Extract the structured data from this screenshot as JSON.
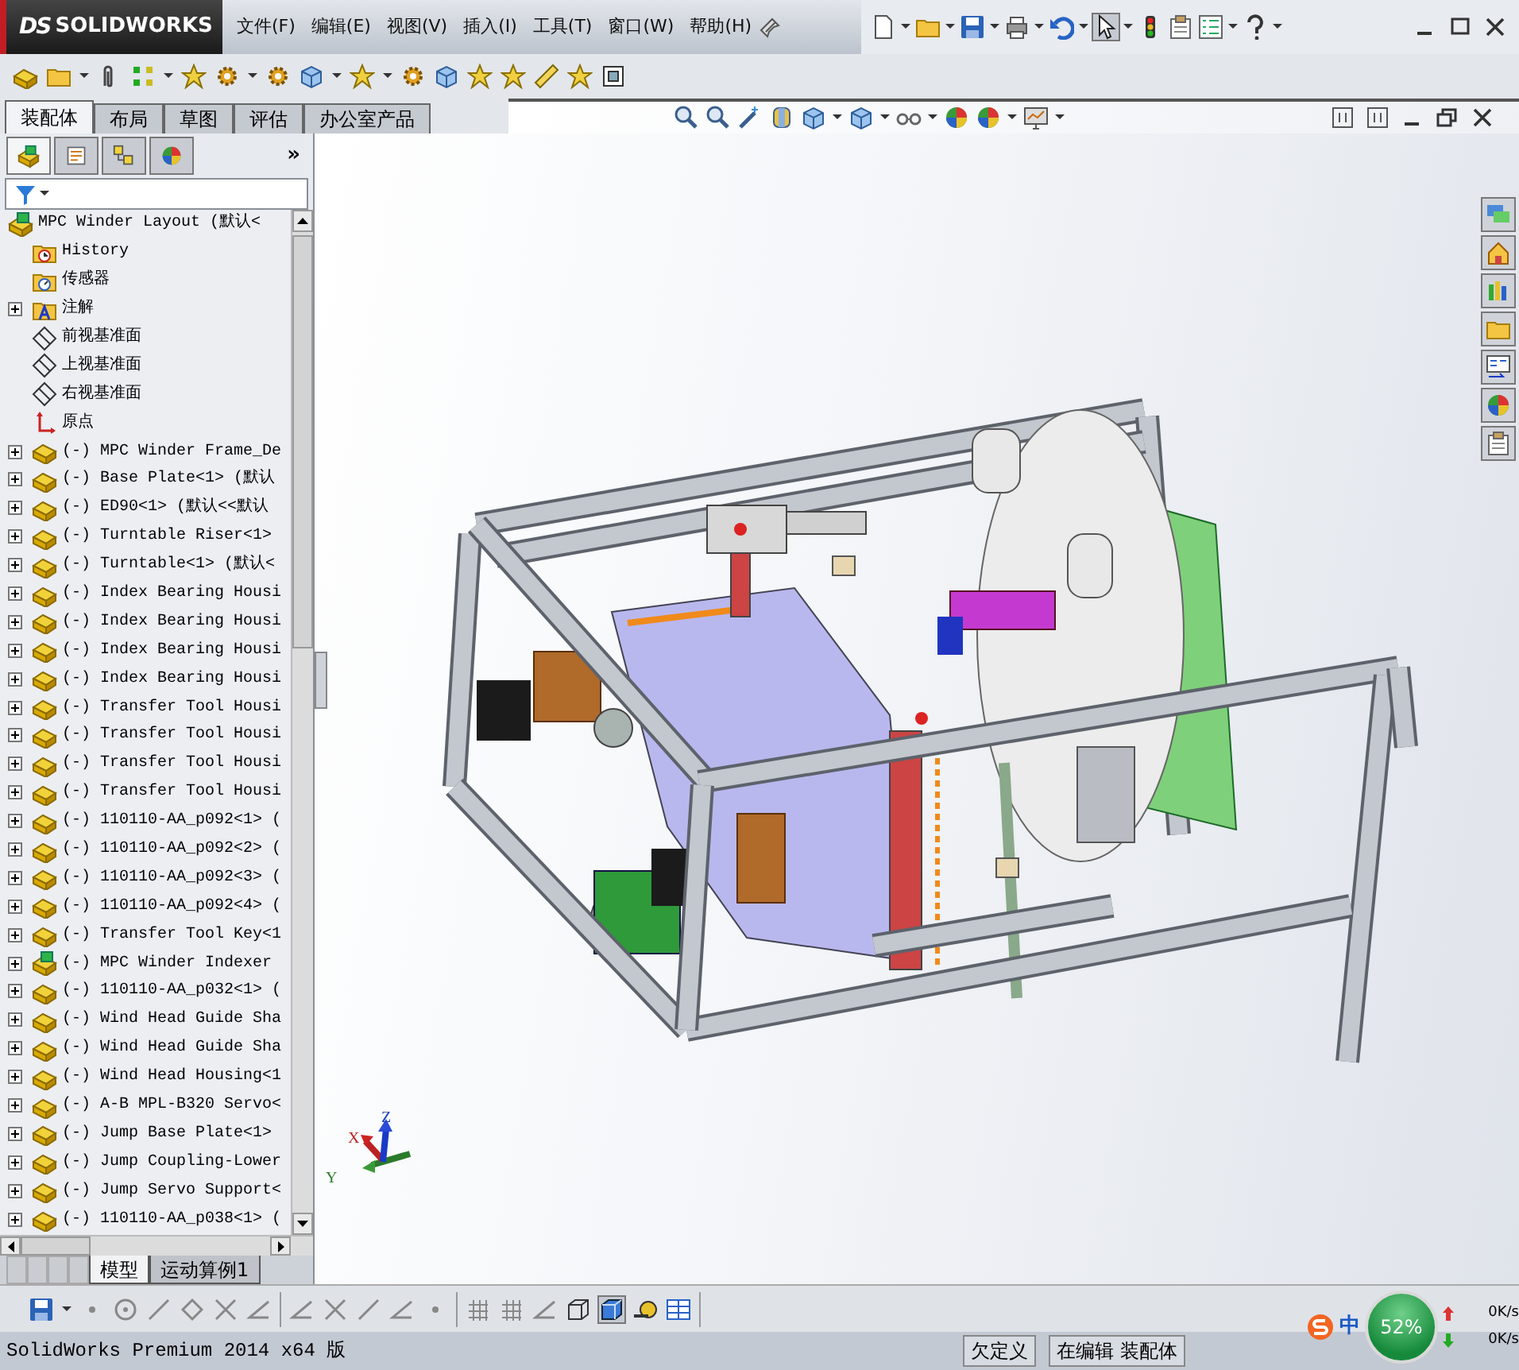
{
  "app": {
    "logo_mark": "DS",
    "logo_text": "SOLIDWORKS"
  },
  "menus": [
    "文件(F)",
    "编辑(E)",
    "视图(V)",
    "插入(I)",
    "工具(T)",
    "窗口(W)",
    "帮助(H)"
  ],
  "command_tabs": [
    {
      "label": "装配体",
      "selected": true
    },
    {
      "label": "布局",
      "selected": false
    },
    {
      "label": "草图",
      "selected": false
    },
    {
      "label": "评估",
      "selected": false
    },
    {
      "label": "办公室产品",
      "selected": false
    }
  ],
  "panel_tabs": [
    {
      "kind": "feature-tree",
      "selected": true
    },
    {
      "kind": "properties",
      "selected": false
    },
    {
      "kind": "configurations",
      "selected": false
    },
    {
      "kind": "display",
      "selected": false
    }
  ],
  "panel_more": "»",
  "tree": [
    {
      "kind": "assembly",
      "label": "MPC Winder Layout  (默认<",
      "children": [
        {
          "kind": "history",
          "label": "History",
          "expandable": false
        },
        {
          "kind": "sensors",
          "label": "传感器",
          "expandable": false
        },
        {
          "kind": "annotations",
          "label": "注解",
          "expandable": true
        },
        {
          "kind": "plane",
          "label": "前视基准面",
          "expandable": false
        },
        {
          "kind": "plane",
          "label": "上视基准面",
          "expandable": false
        },
        {
          "kind": "plane",
          "label": "右视基准面",
          "expandable": false
        },
        {
          "kind": "origin",
          "label": "原点",
          "expandable": false
        },
        {
          "kind": "part",
          "label": "(-) MPC Winder Frame_De",
          "expandable": true
        },
        {
          "kind": "part",
          "label": "(-) Base Plate<1> (默认",
          "expandable": true
        },
        {
          "kind": "part",
          "label": "(-) ED90<1> (默认<<默认",
          "expandable": true
        },
        {
          "kind": "part",
          "label": "(-) Turntable Riser<1>",
          "expandable": true
        },
        {
          "kind": "part",
          "label": "(-) Turntable<1> (默认<",
          "expandable": true
        },
        {
          "kind": "part",
          "label": "(-) Index Bearing Housi",
          "expandable": true
        },
        {
          "kind": "part",
          "label": "(-) Index Bearing Housi",
          "expandable": true
        },
        {
          "kind": "part",
          "label": "(-) Index Bearing Housi",
          "expandable": true
        },
        {
          "kind": "part",
          "label": "(-) Index Bearing Housi",
          "expandable": true
        },
        {
          "kind": "part",
          "label": "(-) Transfer Tool Housi",
          "expandable": true
        },
        {
          "kind": "part",
          "label": "(-) Transfer Tool Housi",
          "expandable": true
        },
        {
          "kind": "part",
          "label": "(-) Transfer Tool Housi",
          "expandable": true
        },
        {
          "kind": "part",
          "label": "(-) Transfer Tool Housi",
          "expandable": true
        },
        {
          "kind": "part",
          "label": "(-) 110110-AA_p092<1> (",
          "expandable": true
        },
        {
          "kind": "part",
          "label": "(-) 110110-AA_p092<2> (",
          "expandable": true
        },
        {
          "kind": "part",
          "label": "(-) 110110-AA_p092<3> (",
          "expandable": true
        },
        {
          "kind": "part",
          "label": "(-) 110110-AA_p092<4> (",
          "expandable": true
        },
        {
          "kind": "part",
          "label": "(-) Transfer Tool Key<1",
          "expandable": true
        },
        {
          "kind": "subassembly",
          "label": "(-) MPC Winder Indexer",
          "expandable": true
        },
        {
          "kind": "part",
          "label": "(-) 110110-AA_p032<1> (",
          "expandable": true
        },
        {
          "kind": "part",
          "label": "(-) Wind Head Guide Sha",
          "expandable": true
        },
        {
          "kind": "part",
          "label": "(-) Wind Head Guide Sha",
          "expandable": true
        },
        {
          "kind": "part",
          "label": "(-) Wind Head Housing<1",
          "expandable": true
        },
        {
          "kind": "part",
          "label": "(-) A-B MPL-B320 Servo<",
          "expandable": true
        },
        {
          "kind": "part",
          "label": "(-) Jump Base Plate<1>",
          "expandable": true
        },
        {
          "kind": "part",
          "label": "(-) Jump Coupling-Lower",
          "expandable": true
        },
        {
          "kind": "part",
          "label": "(-) Jump Servo Support<",
          "expandable": true
        },
        {
          "kind": "part",
          "label": "(-) 110110-AA_p038<1> (",
          "expandable": true
        }
      ]
    }
  ],
  "model_tabs": [
    {
      "label": "模型",
      "selected": true
    },
    {
      "label": "运动算例1",
      "selected": false
    }
  ],
  "triad": {
    "x": "X",
    "y": "Y",
    "z": "Z"
  },
  "status_bar": {
    "product": "SolidWorks Premium 2014 x64 版",
    "fields": [
      "欠定义",
      "在编辑 装配体"
    ]
  },
  "tray": {
    "ime": "中",
    "meter": "52%",
    "upload": "0K/s",
    "download": "0K/s"
  }
}
